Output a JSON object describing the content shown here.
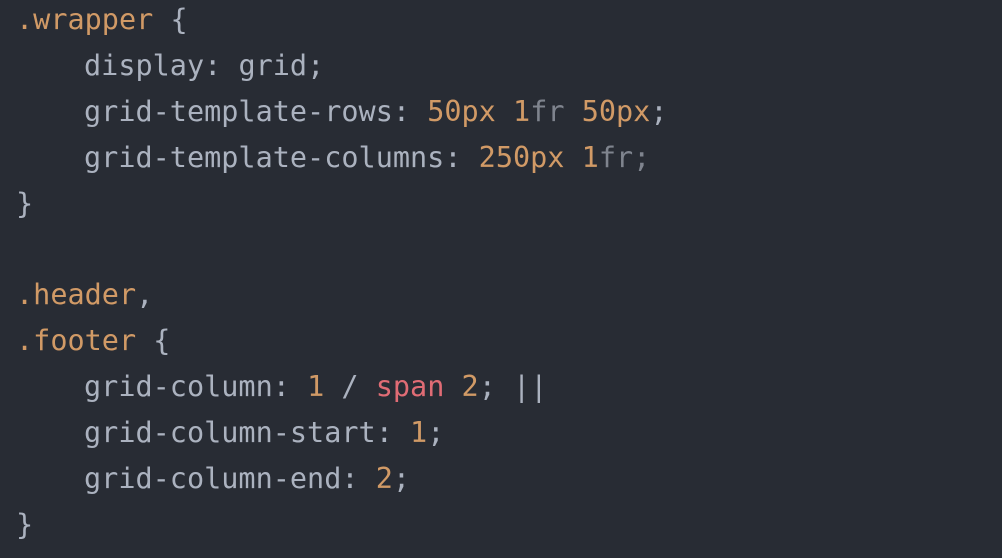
{
  "code": {
    "l1": {
      "selector": ".wrapper",
      "brace": " {"
    },
    "l2": {
      "prop": "display",
      "sep": ": ",
      "value": "grid",
      "end": ";"
    },
    "l3": {
      "prop": "grid-template-rows",
      "sep": ": ",
      "n1": "50",
      "u1": "px",
      "sp1": " ",
      "n2": "1",
      "u2": "fr",
      "sp2": " ",
      "n3": "50",
      "u3": "px",
      "end": ";"
    },
    "l4": {
      "prop": "grid-template-columns",
      "sep": ": ",
      "n1": "250",
      "u1": "px",
      "sp1": " ",
      "n2": "1",
      "u2": "fr",
      "end": ";"
    },
    "l5": {
      "brace": "}"
    },
    "l7": {
      "selector": ".header",
      "comma": ","
    },
    "l8": {
      "selector": ".footer",
      "brace": " {"
    },
    "l9": {
      "prop": "grid-column",
      "sep": ": ",
      "n1": "1",
      "slash": " / ",
      "kw": "span",
      "sp": " ",
      "n2": "2",
      "end": ";",
      "cursor": " ||"
    },
    "l10": {
      "prop": "grid-column-start",
      "sep": ": ",
      "n1": "1",
      "end": ";"
    },
    "l11": {
      "prop": "grid-column-end",
      "sep": ": ",
      "n1": "2",
      "end": ";"
    },
    "l12": {
      "brace": "}"
    }
  },
  "colors": {
    "background": "#282c34",
    "selector": "#d19a66",
    "text": "#abb2bf",
    "number": "#d19a66",
    "keyword": "#e06c75",
    "dim": "#7f848e"
  }
}
